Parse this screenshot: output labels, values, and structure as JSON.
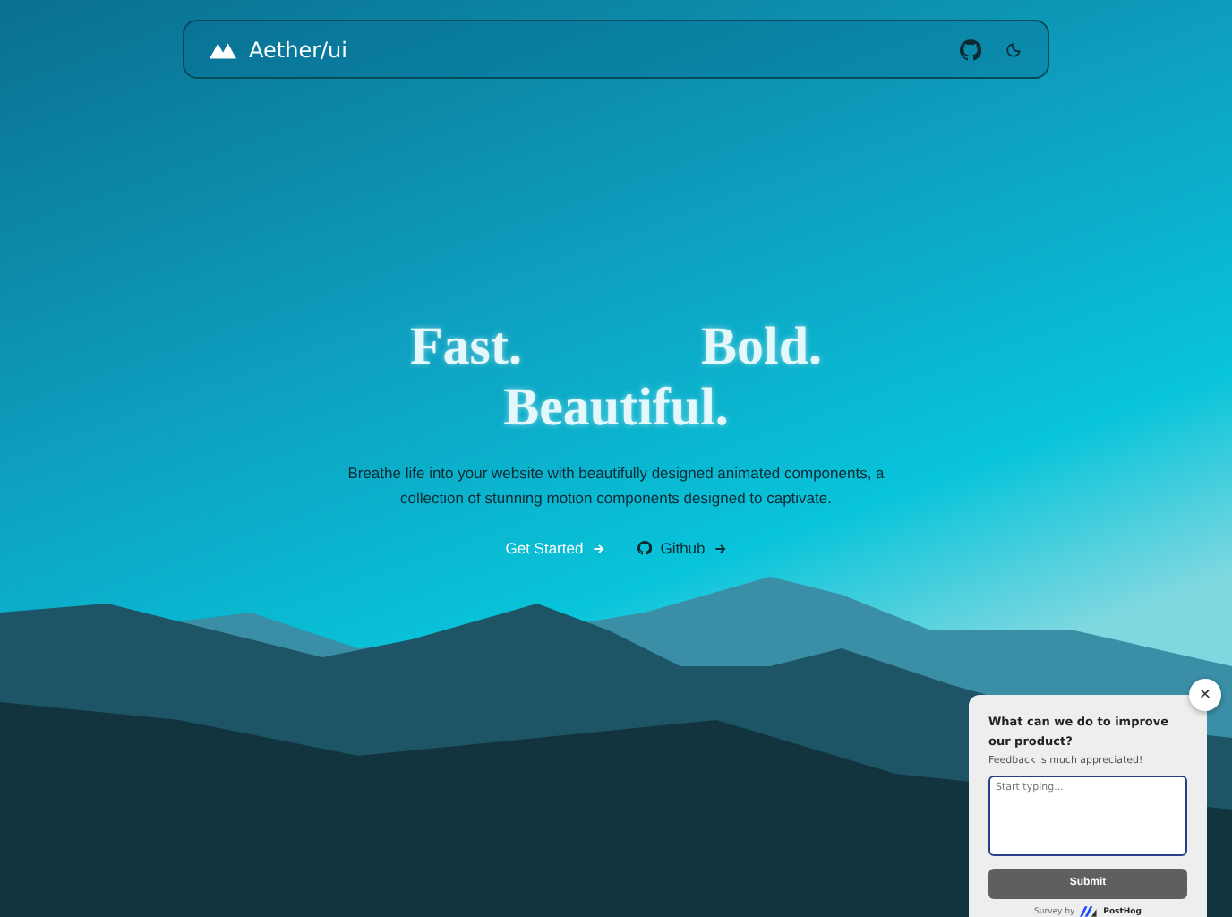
{
  "navbar": {
    "brand": "Aether/ui"
  },
  "hero": {
    "words": [
      "Fast.",
      "Bold.",
      "Beautiful."
    ],
    "tagline": "Breathe life into your website with beautifully designed animated components, a collection of stunning motion components designed to captivate.",
    "actions": [
      {
        "kind": "primary",
        "label": "Get Started"
      },
      {
        "kind": "github",
        "label": "Github"
      }
    ]
  },
  "survey": {
    "close": "×",
    "question": "What can we do to improve our product?",
    "subtitle": "Feedback is much appreciated!",
    "placeholder": "Start typing...",
    "submit": "Submit",
    "footer": "Survey by",
    "brand": "PostHog"
  }
}
